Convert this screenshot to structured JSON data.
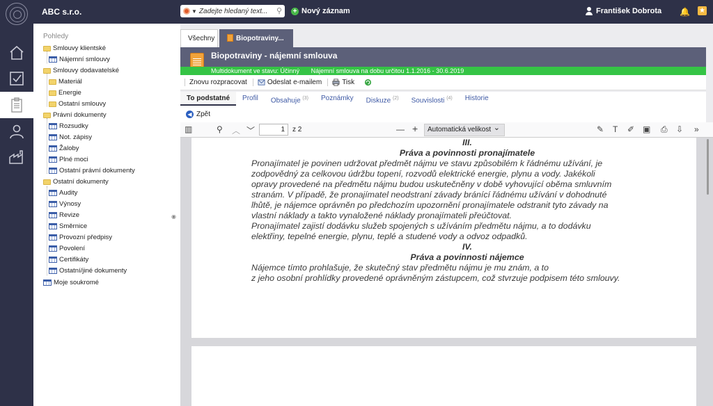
{
  "header": {
    "company": "ABC s.r.o.",
    "search_placeholder": "Zadejte hledaný text...",
    "new_record": "Nový záznam",
    "user_name": "František Dobrota"
  },
  "tree": {
    "title": "Pohledy",
    "items": [
      {
        "label": "Smlouvy klientské"
      },
      {
        "label": "Nájemní smlouvy"
      },
      {
        "label": "Smlouvy dodavatelské"
      },
      {
        "label": "Materiál"
      },
      {
        "label": "Energie"
      },
      {
        "label": "Ostatní smlouvy"
      },
      {
        "label": "Právní dokumenty"
      },
      {
        "label": "Rozsudky"
      },
      {
        "label": "Not. zápisy"
      },
      {
        "label": "Žaloby"
      },
      {
        "label": "Plné moci"
      },
      {
        "label": "Ostatní právní dokumenty"
      },
      {
        "label": "Ostatní dokumenty"
      },
      {
        "label": "Audity"
      },
      {
        "label": "Výnosy"
      },
      {
        "label": "Revize"
      },
      {
        "label": "Směrnice"
      },
      {
        "label": "Provozní předpisy"
      },
      {
        "label": "Povolení"
      },
      {
        "label": "Certifikáty"
      },
      {
        "label": "Ostatní/jiné dokumenty"
      },
      {
        "label": "Moje soukromé"
      }
    ]
  },
  "tabs": {
    "all": "Všechny",
    "active": "Biopotraviny..."
  },
  "document": {
    "title": "Biopotraviny - nájemní smlouva",
    "status": "Multidokument ve stavu: Účinný",
    "contract": "Nájemní smlouva na dobu určitou 1.1.2016 - 30.6.2019"
  },
  "actions": {
    "reprocess": "Znovu rozpracovat",
    "email": "Odeslat e-mailem",
    "print": "Tisk"
  },
  "subtabs": {
    "essential": "To podstatné",
    "profile": "Profil",
    "contains": "Obsahuje",
    "contains_count": "(3)",
    "notes": "Poznámky",
    "discussion": "Diskuze",
    "discussion_count": "(2)",
    "relations": "Souvislosti",
    "relations_count": "(4)",
    "history": "Historie"
  },
  "back": "Zpět",
  "pdf": {
    "page": "1",
    "of_pages": "z 2",
    "zoom": "Automatická velikost",
    "lines": [
      "III.",
      "Práva a povinnosti pronajímatele",
      "Pronajímatel je povinen udržovat předmět nájmu ve stavu způsobilém k řádnému užívání, je",
      "zodpovědný za celkovou údržbu topení, rozvodů elektrické energie, plynu  a vody. Jakékoli",
      "opravy provedené na předmětu nájmu budou uskutečněny v době vyhovující oběma smluvním",
      "stranám. V případě, že pronajímatel neodstraní závady bránící řádnému užívání v dohodnuté",
      "lhůtě, je nájemce oprávněn po předchozím upozornění pronajímatele odstranit tyto závady na",
      "vlastní náklady a takto vynaložené náklady pronajímateli přeúčtovat.",
      "Pronajímatel zajistí dodávku služeb spojených s užíváním předmětu nájmu, a to dodávku",
      "elektřiny, tepelné energie, plynu, teplé a studené vody a odvoz odpadků.",
      "IV.",
      "Práva a povinnosti nájemce",
      "Nájemce tímto prohlašuje, že skutečný stav předmětu nájmu je mu znám, a to",
      "z jeho osobní prohlídky provedené oprávněným zástupcem, což stvrzuje podpisem této smlouvy."
    ]
  },
  "colors": {
    "navy": "#2e3148",
    "slate": "#5c6079",
    "status_green": "#35c445"
  }
}
